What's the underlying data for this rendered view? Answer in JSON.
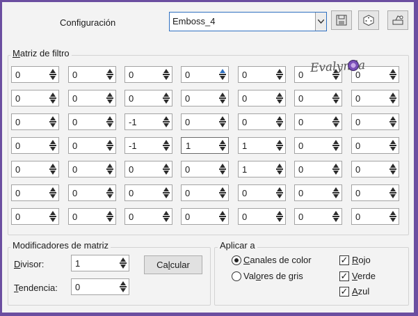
{
  "header": {
    "config_label": "Configuración",
    "preset_value": "Emboss_4",
    "buttons": [
      "save-preset",
      "random-preset",
      "reset-preset"
    ]
  },
  "matrix": {
    "title_prefix": "M",
    "title_rest": "atriz de filtro",
    "rows": [
      [
        "0",
        "0",
        "0",
        "0",
        "0",
        "0",
        "0"
      ],
      [
        "0",
        "0",
        "0",
        "0",
        "0",
        "0",
        "0"
      ],
      [
        "0",
        "0",
        "-1",
        "0",
        "0",
        "0",
        "0"
      ],
      [
        "0",
        "0",
        "-1",
        "1",
        "1",
        "0",
        "0"
      ],
      [
        "0",
        "0",
        "0",
        "0",
        "1",
        "0",
        "0"
      ],
      [
        "0",
        "0",
        "0",
        "0",
        "0",
        "0",
        "0"
      ],
      [
        "0",
        "0",
        "0",
        "0",
        "0",
        "0",
        "0"
      ]
    ]
  },
  "watermark": "Evalynda",
  "modifiers": {
    "title": "Modificadores de matriz",
    "divisor_label": "Divisor:",
    "divisor_value": "1",
    "bias_label": "Tendencia:",
    "bias_value": "0",
    "calc_label": "Calcular"
  },
  "apply": {
    "title": "Aplicar a",
    "color_channels": "Canales de color",
    "gray_values": "Valores de gris",
    "red": "Rojo",
    "green": "Verde",
    "blue": "Azul"
  },
  "colors": {
    "accent": "#2d6fc0",
    "frame": "#6b4ea0"
  }
}
